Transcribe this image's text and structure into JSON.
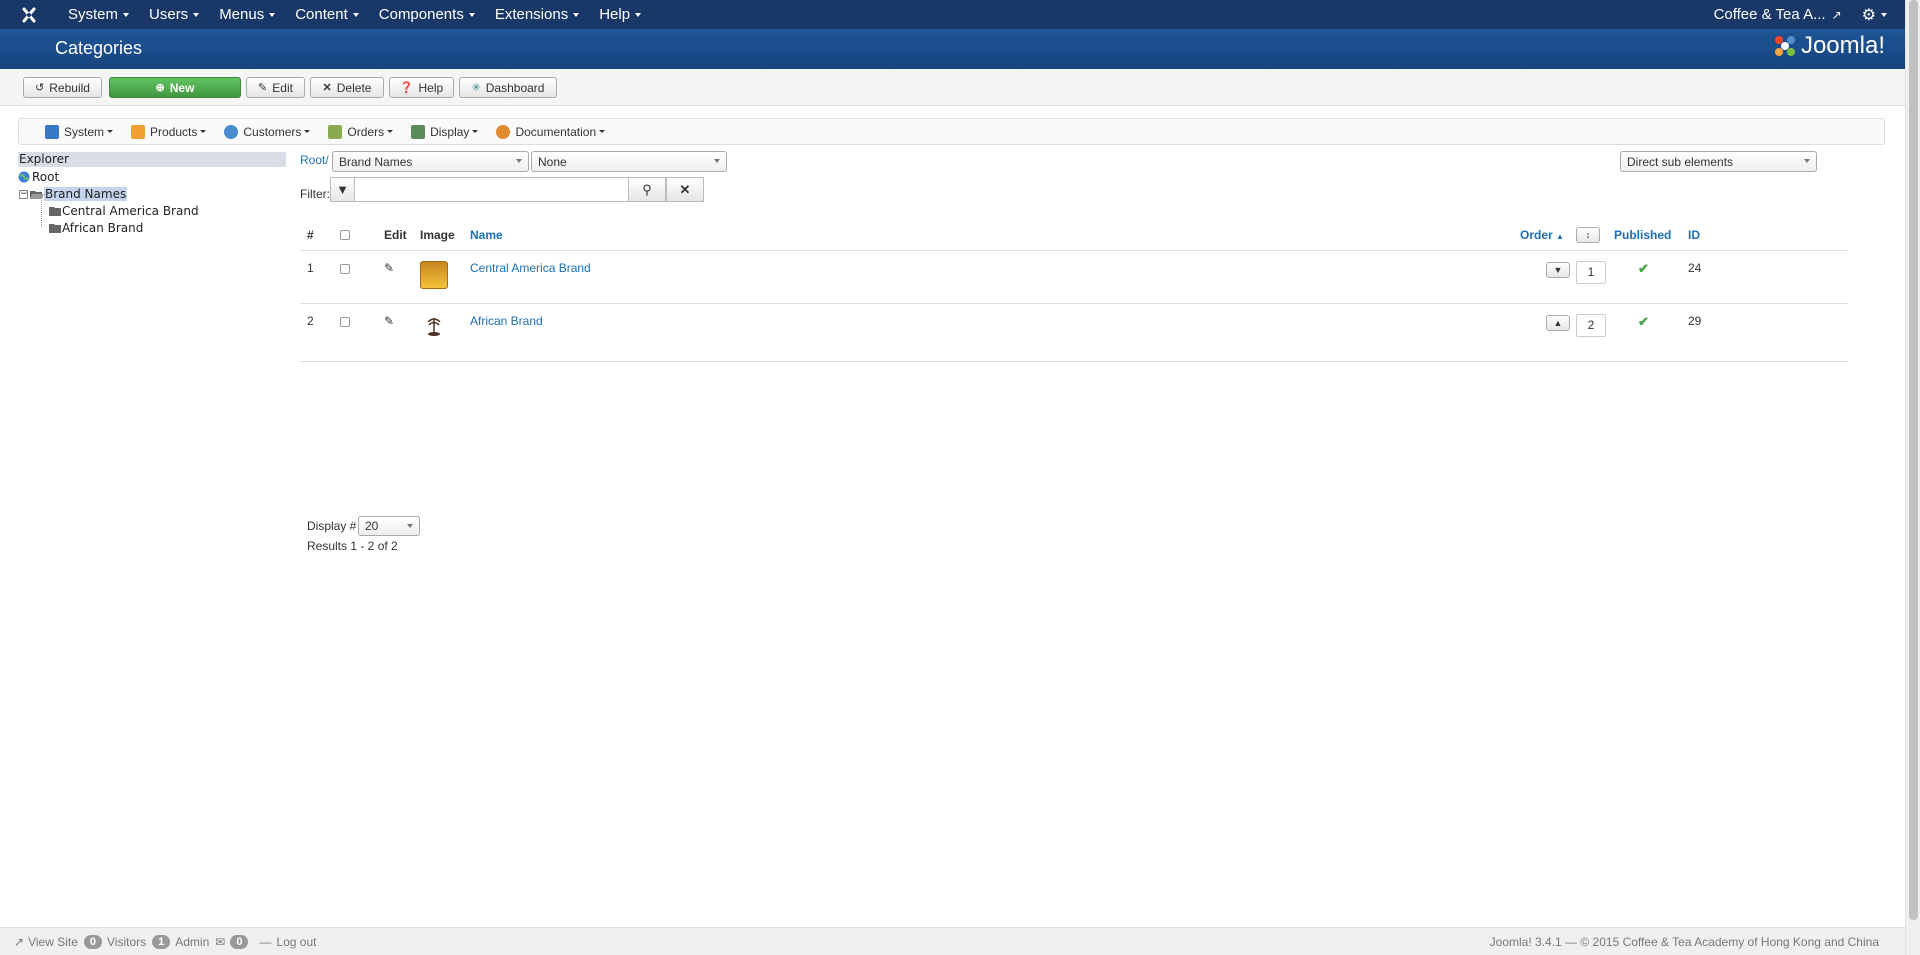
{
  "topnav": {
    "menus": [
      {
        "label": "System"
      },
      {
        "label": "Users"
      },
      {
        "label": "Menus"
      },
      {
        "label": "Content"
      },
      {
        "label": "Components"
      },
      {
        "label": "Extensions"
      },
      {
        "label": "Help"
      }
    ],
    "site_name": "Coffee & Tea A..."
  },
  "header": {
    "title": "Categories",
    "brand": "Joomla!"
  },
  "toolbar": {
    "rebuild": "Rebuild",
    "new": "New",
    "edit": "Edit",
    "delete": "Delete",
    "help": "Help",
    "dashboard": "Dashboard"
  },
  "submenu": [
    {
      "label": "System",
      "icon": "tools-icon",
      "color": "#3a77c4"
    },
    {
      "label": "Products",
      "icon": "products-icon",
      "color": "#f0a030"
    },
    {
      "label": "Customers",
      "icon": "customers-icon",
      "color": "#4a8ad0"
    },
    {
      "label": "Orders",
      "icon": "orders-icon",
      "color": "#8aaa50"
    },
    {
      "label": "Display",
      "icon": "display-icon",
      "color": "#5a8a5a"
    },
    {
      "label": "Documentation",
      "icon": "documentation-icon",
      "color": "#e08a30"
    }
  ],
  "explorer": {
    "title": "Explorer",
    "root": "Root",
    "brand_names": "Brand Names",
    "children": [
      "Central America Brand",
      "African Brand"
    ]
  },
  "filters": {
    "breadcrumb": "Root/",
    "category": "Brand Names",
    "second": "None",
    "scope": "Direct sub elements",
    "filter_label": "Filter:"
  },
  "table": {
    "headers": {
      "num": "#",
      "edit": "Edit",
      "image": "Image",
      "name": "Name",
      "order": "Order",
      "published": "Published",
      "id": "ID"
    },
    "rows": [
      {
        "num": "1",
        "name": "Central America Brand",
        "order": "1",
        "id": "24"
      },
      {
        "num": "2",
        "name": "African Brand",
        "order": "2",
        "id": "29"
      }
    ]
  },
  "pagination": {
    "display_label": "Display #",
    "display_value": "20",
    "results": "Results 1 - 2 of 2"
  },
  "statusbar": {
    "view_site": "View Site",
    "visitors_count": "0",
    "visitors": "Visitors",
    "admin_count": "1",
    "admin": "Admin",
    "messages_count": "0",
    "logout": "Log out",
    "copyright": "Joomla! 3.4.1  —  © 2015 Coffee & Tea Academy of Hong Kong and China"
  }
}
